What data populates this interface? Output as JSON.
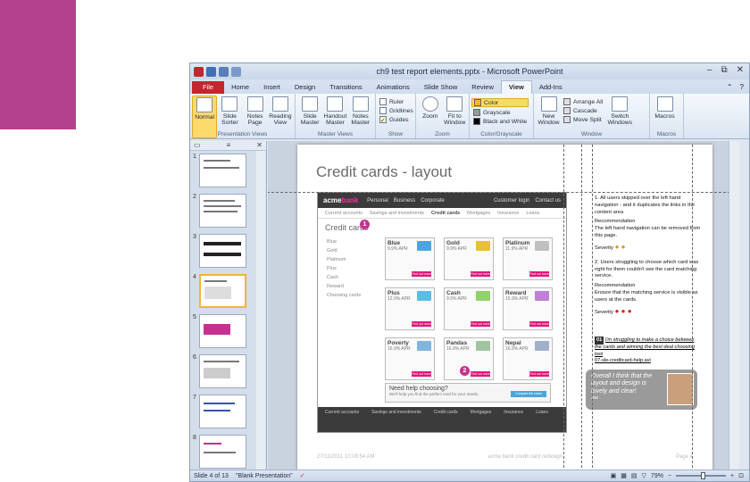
{
  "window": {
    "title": "ch9 test report elements.pptx - Microsoft PowerPoint",
    "controls": [
      "–",
      "⧉",
      "✕"
    ]
  },
  "tabs": [
    {
      "label": "File"
    },
    {
      "label": "Home"
    },
    {
      "label": "Insert"
    },
    {
      "label": "Design"
    },
    {
      "label": "Transitions"
    },
    {
      "label": "Animations"
    },
    {
      "label": "Slide Show"
    },
    {
      "label": "Review"
    },
    {
      "label": "View"
    },
    {
      "label": "Add-Ins"
    }
  ],
  "ribbon": {
    "presentation_views": {
      "label": "Presentation Views",
      "buttons": [
        "Normal",
        "Slide Sorter",
        "Notes Page",
        "Reading View"
      ]
    },
    "master_views": {
      "label": "Master Views",
      "buttons": [
        "Slide Master",
        "Handout Master",
        "Notes Master"
      ]
    },
    "show": {
      "label": "Show",
      "items": [
        "Ruler",
        "Gridlines",
        "Guides"
      ]
    },
    "zoom": {
      "label": "Zoom",
      "buttons": [
        "Zoom",
        "Fit to Window"
      ]
    },
    "color": {
      "label": "Color/Grayscale",
      "items": [
        "Color",
        "Grayscale",
        "Black and White"
      ]
    },
    "window": {
      "label": "Window",
      "new_window": "New Window",
      "items": [
        "Arrange All",
        "Cascade",
        "Move Split"
      ],
      "switch": "Switch Windows"
    },
    "macros": {
      "label": "Macros",
      "button": "Macros"
    }
  },
  "thumbnails": [
    "1",
    "2",
    "3",
    "4",
    "5",
    "6",
    "7",
    "8"
  ],
  "slide": {
    "title": "Credit cards - layout",
    "site": {
      "logo_a": "acme",
      "logo_b": "bank",
      "nav": [
        "Personal",
        "Business",
        "Corporate",
        "Customer login",
        "Contact us"
      ],
      "subnav": [
        "Current accounts",
        "Savings and investments",
        "Credit cards",
        "Mortgages",
        "Insurance",
        "Loans"
      ],
      "heading": "Credit cards",
      "side": [
        "Blue",
        "Gold",
        "Platinum",
        "Plus",
        "Cash",
        "Reward",
        "Choosing cards"
      ],
      "cards": [
        {
          "name": "Blue",
          "apr": "9.9% APR",
          "color": "#4ba6e0"
        },
        {
          "name": "Gold",
          "apr": "9.9% APR",
          "color": "#e8c13a"
        },
        {
          "name": "Platinum",
          "apr": "11.9% APR",
          "color": "#c0c0c0"
        },
        {
          "name": "Plus",
          "apr": "12.9% APR",
          "color": "#5bbce4"
        },
        {
          "name": "Cash",
          "apr": "9.9% APR",
          "color": "#8fd16a"
        },
        {
          "name": "Reward",
          "apr": "15.9% APR",
          "color": "#c080d8"
        },
        {
          "name": "Poverty",
          "apr": "16.9% APR",
          "color": "#7fb6e0"
        },
        {
          "name": "Pandas",
          "apr": "16.9% APR",
          "color": "#a0c4a0"
        },
        {
          "name": "Nepal",
          "apr": "16.9% APR",
          "color": "#9fb0c8"
        }
      ],
      "find_out": "Find out more",
      "help_title": "Need help choosing?",
      "help_sub": "We'll help you find the perfect card for your needs.",
      "help_btn": "Compare the cards",
      "footer": [
        "Current accounts",
        "Savings and investments",
        "Credit cards",
        "Mortgages",
        "Insurance",
        "Loans"
      ]
    },
    "markers": [
      "1",
      "2"
    ],
    "notes": {
      "n1": "1. All users skipped over the left hand navigation - and it duplicates the links in the content area",
      "rec": "Recommendation",
      "r1": "The left hand navigation can be removed from this page.",
      "sev": "Severity",
      "n2": "2. Users struggling to choose which card was right for them couldn't see the card matching service.",
      "r2": "Ensure that the matching service is visible as users at the cards."
    },
    "link_icon": "01",
    "link_text": "I'm struggling to make a choice between the cards and winning the best deal choosing tool",
    "link_path": "07-sle-creditcard-help.avi",
    "bubble": "Overall I think that the layout and design is lovely and clear!",
    "bubble_sub": "Joe",
    "footer_left": "27/11/2011 10:08:54 AM",
    "footer_center": "acme bank credit card redesign",
    "footer_right": "Page 4"
  },
  "status": {
    "slide": "Slide 4 of 13",
    "theme": "\"Blank Presentation\"",
    "zoom": "79%"
  }
}
